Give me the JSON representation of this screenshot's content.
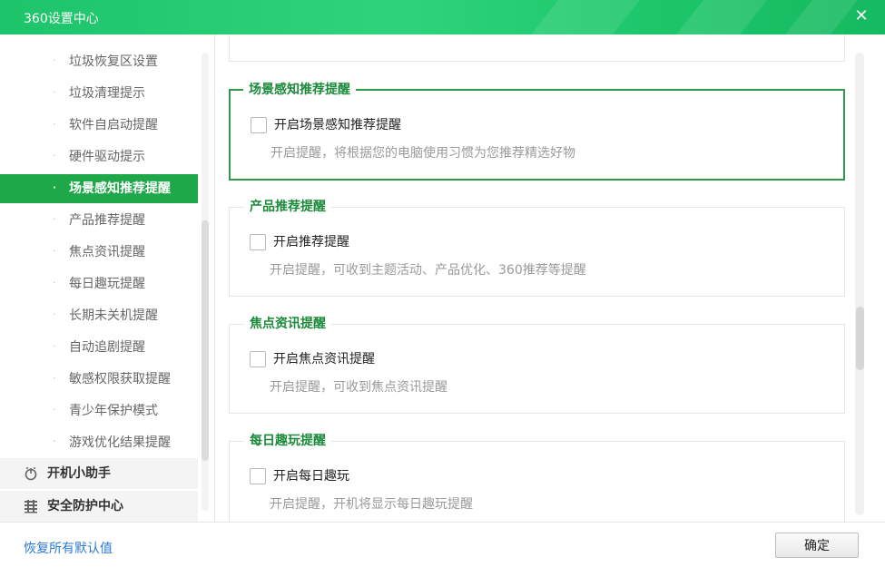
{
  "window": {
    "title": "360设置中心",
    "close_glyph": "✕"
  },
  "sidebar": {
    "bullet": "·",
    "items": [
      {
        "label": "垃圾恢复区设置",
        "active": false
      },
      {
        "label": "垃圾清理提示",
        "active": false
      },
      {
        "label": "软件自启动提醒",
        "active": false
      },
      {
        "label": "硬件驱动提示",
        "active": false
      },
      {
        "label": "场景感知推荐提醒",
        "active": true
      },
      {
        "label": "产品推荐提醒",
        "active": false
      },
      {
        "label": "焦点资讯提醒",
        "active": false
      },
      {
        "label": "每日趣玩提醒",
        "active": false
      },
      {
        "label": "长期未关机提醒",
        "active": false
      },
      {
        "label": "自动追剧提醒",
        "active": false
      },
      {
        "label": "敏感权限获取提醒",
        "active": false
      },
      {
        "label": "青少年保护模式",
        "active": false
      },
      {
        "label": "游戏优化结果提醒",
        "active": false
      }
    ],
    "groups": [
      {
        "label": "开机小助手",
        "icon": "power-icon"
      },
      {
        "label": "安全防护中心",
        "icon": "shield-icon"
      }
    ]
  },
  "main": {
    "sections": [
      {
        "title": "场景感知推荐提醒",
        "checkbox_label": "开启场景感知推荐提醒",
        "checked": false,
        "description": "开启提醒，将根据您的电脑使用习惯为您推荐精选好物",
        "active": true
      },
      {
        "title": "产品推荐提醒",
        "checkbox_label": "开启推荐提醒",
        "checked": false,
        "description": "开启提醒，可收到主题活动、产品优化、360推荐等提醒",
        "active": false
      },
      {
        "title": "焦点资讯提醒",
        "checkbox_label": "开启焦点资讯提醒",
        "checked": false,
        "description": "开启提醒，可收到焦点资讯提醒",
        "active": false
      },
      {
        "title": "每日趣玩提醒",
        "checkbox_label": "开启每日趣玩",
        "checked": false,
        "description": "开启提醒，开机将显示每日趣玩提醒",
        "active": false
      }
    ]
  },
  "footer": {
    "restore_label": "恢复所有默认值",
    "ok_label": "确定"
  },
  "colors": {
    "title_bar": "#1dc46a",
    "active_item": "#1fa84a",
    "section_title": "#1b8a3a",
    "link": "#2a7ad5"
  }
}
